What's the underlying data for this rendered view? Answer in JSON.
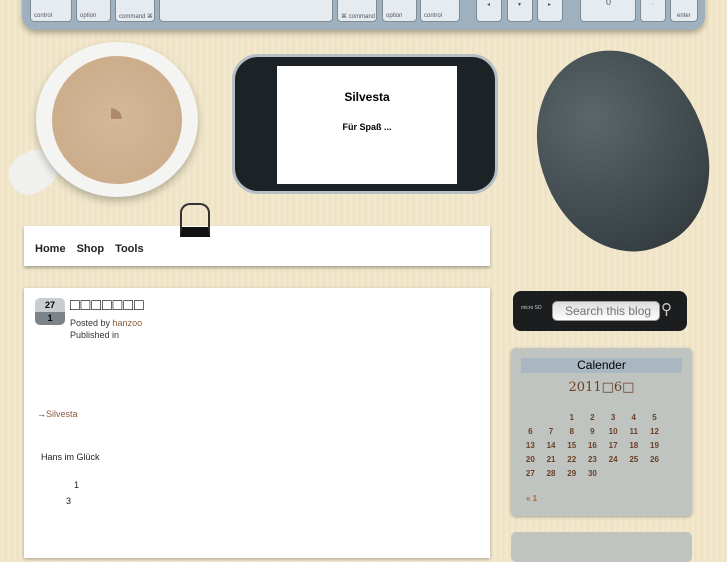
{
  "keyboard": {
    "keys": [
      "control",
      "option",
      "command ⌘",
      "",
      "⌘ command",
      "option",
      "control",
      "◂",
      "▾",
      "▸",
      "0",
      ".",
      "enter"
    ]
  },
  "phone": {
    "title": "Silvesta",
    "subtitle": "Für Spaß ..."
  },
  "nav": {
    "items": [
      "Home",
      "Shop",
      "Tools"
    ]
  },
  "post": {
    "day": "27",
    "month": "1",
    "title": "□□□□□□□",
    "posted_by": "Posted by",
    "author": "hanzoo",
    "published_in": "Published in",
    "link_prefix": "→",
    "link": "Silvesta",
    "line1": "Hans im Glück",
    "line2": "1",
    "line3": "3"
  },
  "search": {
    "placeholder": "Search this blog",
    "logo": "micro SD"
  },
  "calendar": {
    "title": "Calender",
    "caption": "2011□6□",
    "weeks": [
      [
        "",
        "",
        "1",
        "2",
        "3",
        "4",
        "5"
      ],
      [
        "6",
        "7",
        "8",
        "9",
        "10",
        "11",
        "12"
      ],
      [
        "13",
        "14",
        "15",
        "16",
        "17",
        "18",
        "19"
      ],
      [
        "20",
        "21",
        "22",
        "23",
        "24",
        "25",
        "26"
      ],
      [
        "27",
        "28",
        "29",
        "30",
        "",
        "",
        ""
      ]
    ],
    "prev": "« 1"
  }
}
